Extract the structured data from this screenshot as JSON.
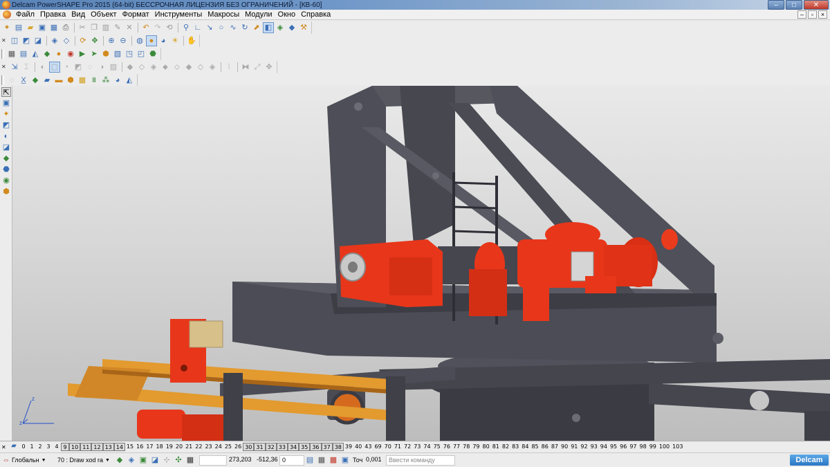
{
  "window": {
    "title": "Delcam PowerSHAPE Pro 2015 (64-bit) БЕССРОЧНАЯ ЛИЦЕНЗИЯ БЕЗ ОГРАНИЧЕНИЙ - [КВ-60]",
    "minimize": "–",
    "maximize": "□",
    "close": "✕"
  },
  "menu": {
    "items": [
      "Файл",
      "Правка",
      "Вид",
      "Объект",
      "Формат",
      "Инструменты",
      "Макросы",
      "Модули",
      "Окно",
      "Справка"
    ],
    "mdi_minimize": "–",
    "mdi_restore": "▫",
    "mdi_close": "×"
  },
  "levels": {
    "numbers": [
      "0",
      "1",
      "2",
      "3",
      "4",
      "9",
      "10",
      "11",
      "12",
      "13",
      "14",
      "15",
      "16",
      "17",
      "18",
      "19",
      "20",
      "21",
      "22",
      "23",
      "24",
      "25",
      "26",
      "30",
      "31",
      "32",
      "33",
      "34",
      "35",
      "36",
      "37",
      "38",
      "39",
      "40",
      "43",
      "69",
      "70",
      "71",
      "72",
      "73",
      "74",
      "75",
      "76",
      "77",
      "78",
      "79",
      "80",
      "81",
      "82",
      "83",
      "84",
      "85",
      "86",
      "87",
      "90",
      "91",
      "92",
      "93",
      "94",
      "95",
      "96",
      "97",
      "98",
      "99",
      "100",
      "103"
    ],
    "boxed": [
      "9",
      "10",
      "11",
      "12",
      "13",
      "14",
      "30",
      "31",
      "32",
      "33",
      "34",
      "35",
      "36",
      "37",
      "38"
    ]
  },
  "status": {
    "workplane": "Глобальн",
    "level_combo": "70 : Draw xod ra",
    "x": "273,203",
    "y": "-512,36",
    "z": "0",
    "tol_label": "Точ",
    "tolerance": "0,001",
    "command_placeholder": "Ввести команду",
    "brand": "Delcam"
  },
  "colors": {
    "accent_red": "#e8361a",
    "frame_gray": "#4b4c55",
    "rail_orange": "#e39a2e",
    "viewport_bg": "#d7d7d7",
    "brand_blue": "#2a76c3"
  },
  "icons": {
    "app": "powershape-logo-icon",
    "triad": "xyz-triad-icon"
  }
}
